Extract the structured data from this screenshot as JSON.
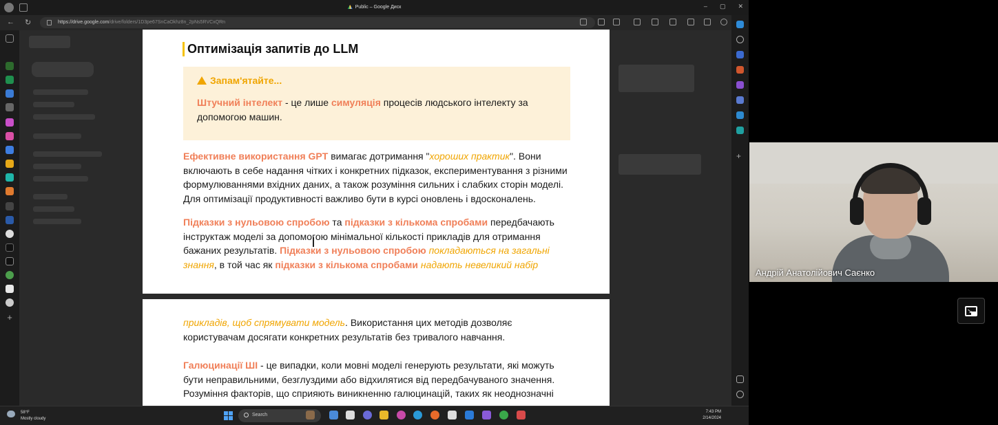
{
  "window": {
    "title": "Public – Google Диск",
    "url_host": "https://drive.google.com",
    "url_path": "/drive/folders/1D3pe67SnCaOkhz8n_2pNs5RVCxQRn"
  },
  "document": {
    "title": "Оптимізація запитів до LLM",
    "callout": {
      "heading": "Запам'ятайте...",
      "hl1": "Штучний інтелект",
      "t1": " - це лише ",
      "hl2": "симуляція",
      "t2": " процесів людського інтелекту за допомогою машин."
    },
    "p1": {
      "hl1": "Ефективне використання GPT",
      "t1": " вимагає дотримання \"",
      "it1": "хороших практик",
      "t2": "\". Вони включають в себе надання чітких і конкретних підказок, експериментування з різними формулюваннями вхідних даних, а також розуміння сильних і слабких сторін моделі. Для оптимізації продуктивності важливо бути в курсі оновлень і вдосконалень."
    },
    "p2": {
      "hl1": "Підказки з нульовою спробою",
      "t1": " та ",
      "hl2": "підказки з кількома спробами",
      "t2": " передбачають інструктаж моделі за допомогою мінімальної кількості прикладів для отримання бажаних результатів. ",
      "hl3": "Підказки з нульовою спробою",
      "it1": " покладаються на загальні знання",
      "t3": ", в той час як ",
      "hl4": "підказки з кількома спробами",
      "it2": " надають невеликий набір"
    },
    "p3": {
      "it1": "прикладів, щоб спрямувати модель",
      "t1": ". Використання цих методів дозволяє користувачам досягати конкретних результатів без тривалого навчання."
    },
    "p4": {
      "hl1": "Галюцинації ШІ",
      "t1": " - це випадки, коли мовні моделі генерують результати, які можуть бути неправильними, безглуздими або відхилятися від передбачуваного значення. Розуміння факторів, що сприяють виникненню галюцинацій, таких як неоднозначні"
    }
  },
  "taskbar": {
    "weather_temp": "58°F",
    "weather_desc": "Mostly cloudy",
    "search_label": "Search",
    "time": "7:43 PM",
    "date": "2/14/2024"
  },
  "video": {
    "participant_name": "Андрій Анатолійович Саєнко"
  },
  "colors": {
    "highlight": "#f07f58",
    "italic_accent": "#f0a500",
    "callout_bg": "#fdf1d9"
  }
}
